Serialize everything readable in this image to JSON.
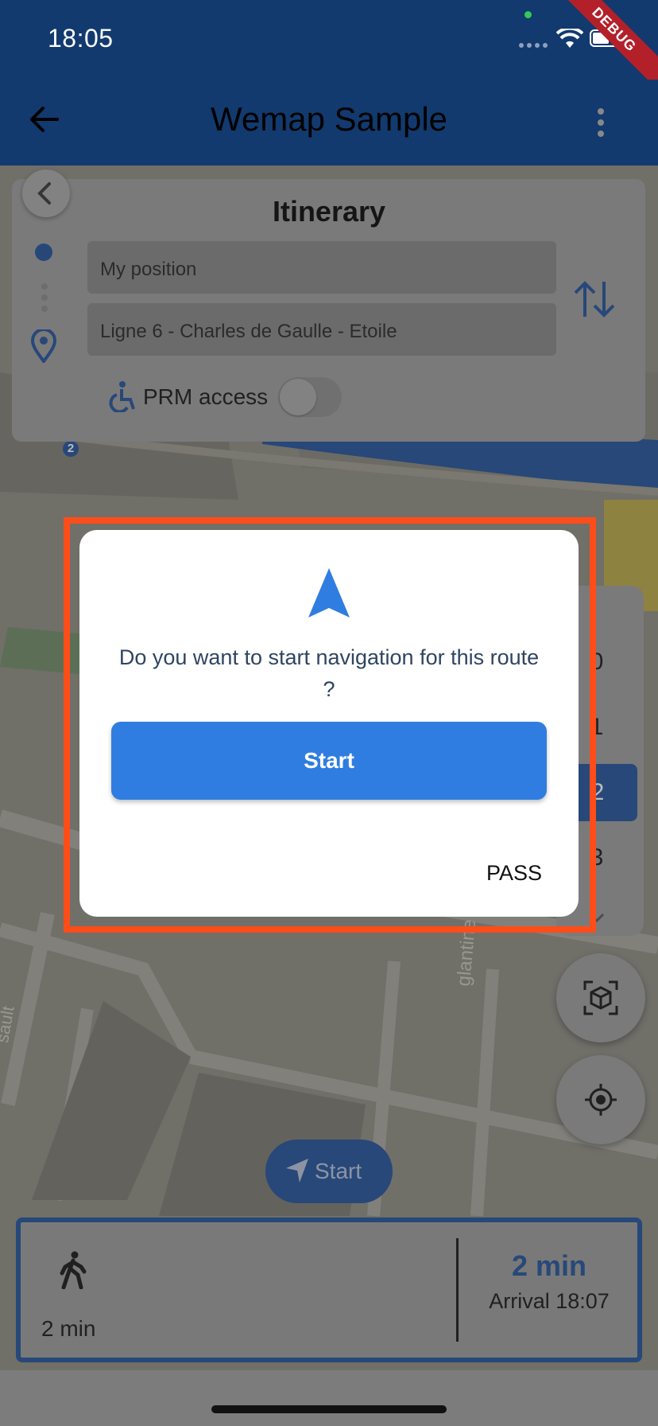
{
  "status_bar": {
    "time": "18:05",
    "debug_label": "DEBUG"
  },
  "app_bar": {
    "title": "Wemap Sample"
  },
  "itinerary": {
    "title": "Itinerary",
    "origin_value": "My position",
    "destination_value": "Ligne 6 - Charles de Gaulle - Etoile",
    "prm_label": "PRM access",
    "prm_enabled": false
  },
  "floors": {
    "items": [
      "0",
      "1",
      "2",
      "3"
    ],
    "selected": "2"
  },
  "map": {
    "start_label": "Start",
    "badge": "2",
    "street_fragments": [
      "glantine",
      "sault"
    ]
  },
  "route_info": {
    "walk_duration": "2 min",
    "total_duration": "2 min",
    "arrival": "Arrival 18:07"
  },
  "dialog": {
    "message": "Do you want to start navigation for this route ?",
    "start_label": "Start",
    "pass_label": "PASS"
  },
  "colors": {
    "accent": "#2f7de1",
    "navy": "#1d4f9a",
    "highlight": "#ff4d1a"
  }
}
